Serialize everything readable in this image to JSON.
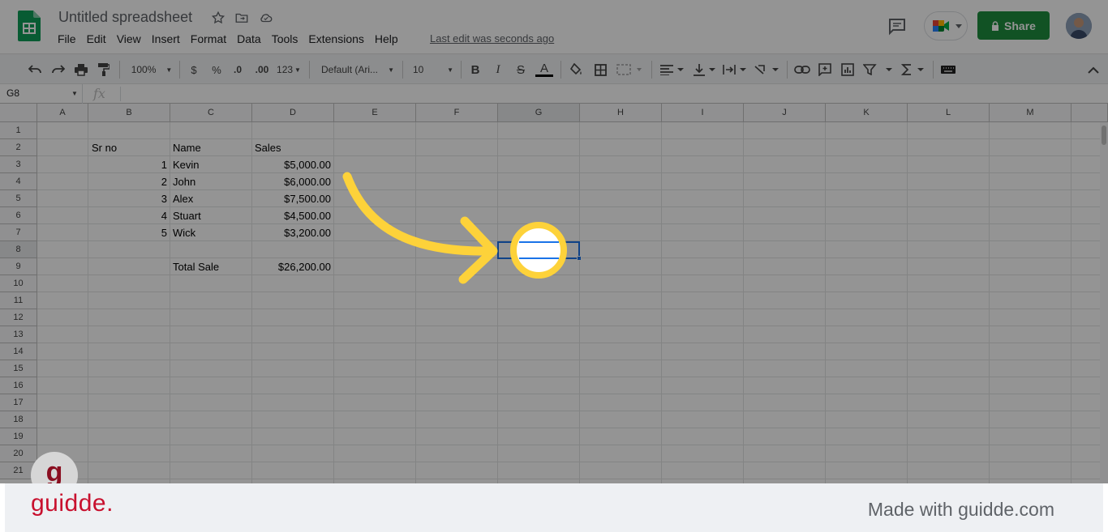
{
  "header": {
    "doc_title": "Untitled spreadsheet",
    "last_edit": "Last edit was seconds ago",
    "share_label": "Share",
    "menu": [
      "File",
      "Edit",
      "View",
      "Insert",
      "Format",
      "Data",
      "Tools",
      "Extensions",
      "Help"
    ]
  },
  "toolbar": {
    "zoom": "100%",
    "currency": "$",
    "percent": "%",
    "dec_decrease": ".0",
    "dec_increase": ".00",
    "more_formats": "123",
    "font_family": "Default (Ari...",
    "font_size": "10",
    "bold": "B",
    "italic": "I",
    "strike": "S",
    "text_color": "A"
  },
  "formula_bar": {
    "name_box": "G8",
    "fx": "fx"
  },
  "sheet": {
    "columns": [
      "A",
      "B",
      "C",
      "D",
      "E",
      "F",
      "G",
      "H",
      "I",
      "J",
      "K",
      "L",
      "M"
    ],
    "rows": [
      "1",
      "2",
      "3",
      "4",
      "5",
      "6",
      "7",
      "8",
      "9",
      "10",
      "11",
      "12",
      "13",
      "14",
      "15",
      "16",
      "17",
      "18",
      "19",
      "20",
      "21"
    ],
    "selected_cell": "G8",
    "headers": {
      "sr_no": "Sr no",
      "name": "Name",
      "sales": "Sales"
    },
    "data": [
      {
        "sr": "1",
        "name": "Kevin",
        "sales": "$5,000.00"
      },
      {
        "sr": "2",
        "name": "John",
        "sales": "$6,000.00"
      },
      {
        "sr": "3",
        "name": "Alex",
        "sales": "$7,500.00"
      },
      {
        "sr": "4",
        "name": "Stuart",
        "sales": "$4,500.00"
      },
      {
        "sr": "5",
        "name": "Wick",
        "sales": "$3,200.00"
      }
    ],
    "total_label": "Total Sale",
    "total_value": "$26,200.00"
  },
  "footer": {
    "brand": "guidde.",
    "made_with": "Made with guidde.com",
    "badge_letter": "g"
  },
  "colors": {
    "share_green": "#1e8e3e",
    "selection_blue": "#1a73e8",
    "highlight_yellow": "#fdd23a",
    "brand_red": "#c8102e"
  }
}
